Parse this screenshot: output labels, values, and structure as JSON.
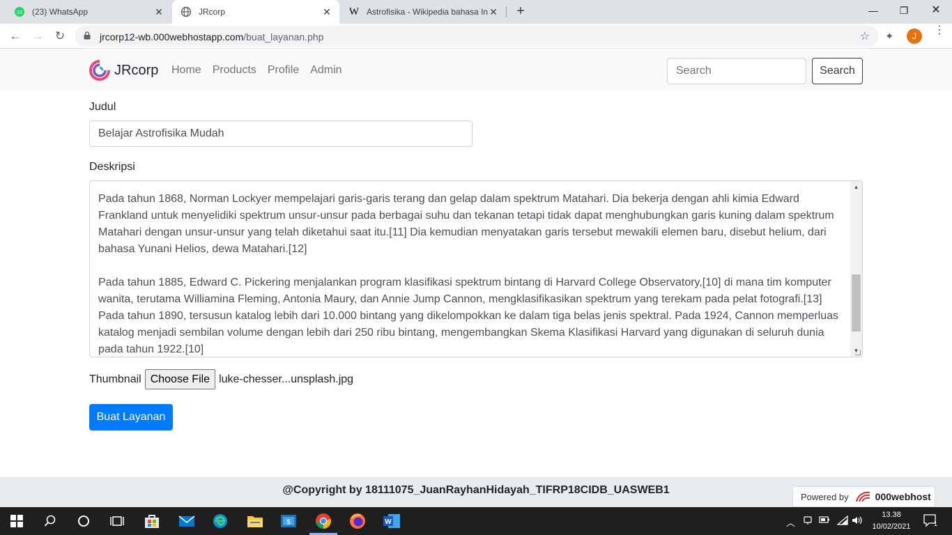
{
  "browser": {
    "tabs": [
      {
        "title": "(23) WhatsApp",
        "badge": "23",
        "icon": "whatsapp-icon",
        "active": false
      },
      {
        "title": "JRcorp",
        "icon": "globe-icon",
        "active": true
      },
      {
        "title": "Astrofisika - Wikipedia bahasa In",
        "icon": "wikipedia-icon",
        "active": false
      }
    ],
    "url_host": "jrcorp12-wb.000webhostapp.com",
    "url_path": "/buat_layanan.php",
    "profile_initial": "J"
  },
  "navbar": {
    "brand": "JRcorp",
    "links": [
      "Home",
      "Products",
      "Profile",
      "Admin"
    ],
    "search_placeholder": "Search",
    "search_button": "Search"
  },
  "form": {
    "judul_label": "Judul",
    "judul_value": "Belajar Astrofisika Mudah",
    "deskripsi_label": "Deskripsi",
    "deskripsi_paragraphs": [
      "Pada tahun 1868, Norman Lockyer mempelajari garis-garis terang dan gelap dalam spektrum Matahari. Dia bekerja dengan ahli kimia Edward Frankland untuk menyelidiki spektrum unsur-unsur pada berbagai suhu dan tekanan tetapi tidak dapat menghubungkan garis kuning dalam spektrum Matahari dengan unsur-unsur yang telah diketahui saat itu.[11] Dia kemudian menyatakan garis tersebut mewakili elemen baru, disebut helium, dari bahasa Yunani Helios, dewa Matahari.[12]",
      "Pada tahun 1885, Edward C. Pickering menjalankan program klasifikasi spektrum bintang di Harvard College Observatory,[10] di mana tim komputer wanita, terutama Williamina Fleming, Antonia Maury, dan Annie Jump Cannon, mengklasifikasikan spektrum yang terekam pada pelat fotografi.[13] Pada tahun 1890, tersusun katalog lebih dari 10.000 bintang yang dikelompokkan ke dalam tiga belas jenis spektral. Pada 1924, Cannon memperluas katalog menjadi sembilan volume dengan lebih dari 250 ribu bintang, mengembangkan Skema Klasifikasi Harvard yang digunakan di seluruh dunia pada tahun 1922.[10]"
    ],
    "thumbnail_label": "Thumbnail",
    "file_button": "Choose File",
    "file_name": "luke-chesser...unsplash.jpg",
    "submit": "Buat Layanan"
  },
  "footer": {
    "copyright": "@Copyright by 18111075_JuanRayhanHidayah_TIFRP18CIDB_UASWEB1",
    "powered_label": "Powered by",
    "powered_brand": "000webhost"
  },
  "taskbar": {
    "time": "13.38",
    "date": "10/02/2021",
    "notifications": "1"
  },
  "colors": {
    "primary": "#007bff",
    "navbar_bg": "#f8f9fa",
    "footer_bg": "#e9ecef",
    "tabstrip_bg": "#dee1e6",
    "taskbar_bg": "#1f1f1f",
    "profile_bg": "#e8710a"
  }
}
